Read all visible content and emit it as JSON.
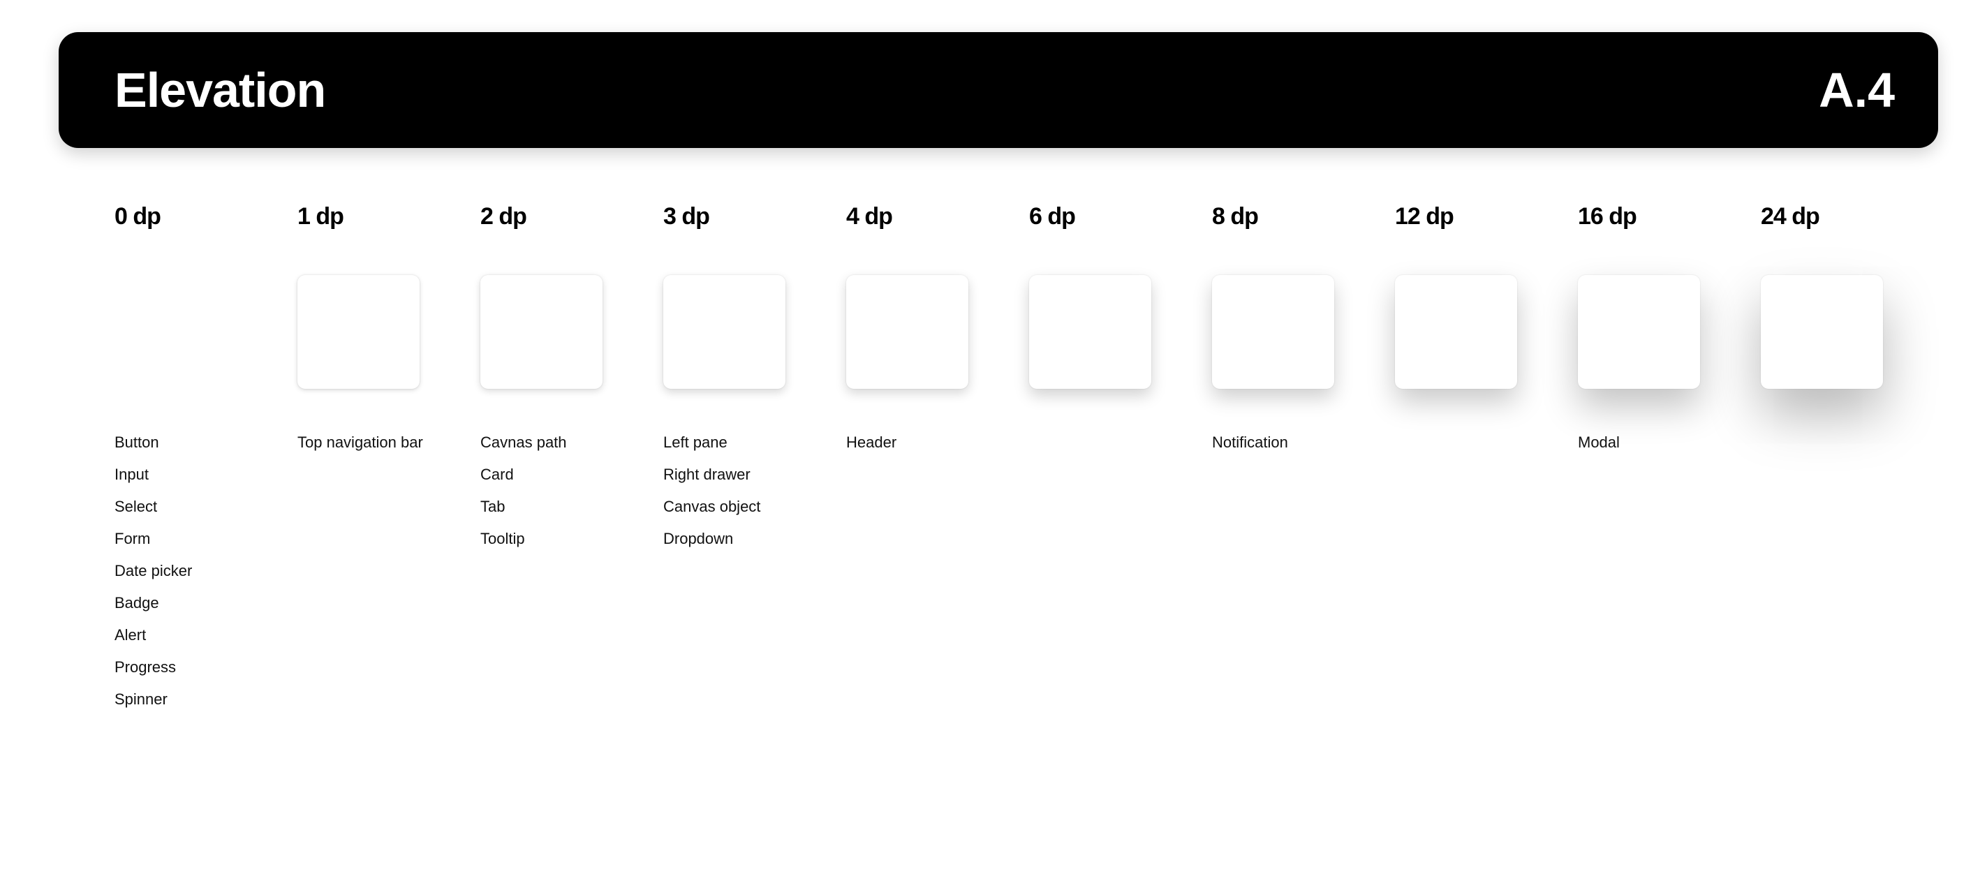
{
  "header": {
    "title": "Elevation",
    "code": "A.4"
  },
  "levels": [
    {
      "label": "0 dp",
      "dp": 0,
      "uses": [
        "Button",
        "Input",
        "Select",
        "Form",
        "Date picker",
        "Badge",
        "Alert",
        "Progress",
        "Spinner"
      ]
    },
    {
      "label": "1 dp",
      "dp": 1,
      "uses": [
        "Top navigation bar"
      ]
    },
    {
      "label": "2 dp",
      "dp": 2,
      "uses": [
        "Cavnas path",
        "Card",
        "Tab",
        "Tooltip"
      ]
    },
    {
      "label": "3 dp",
      "dp": 3,
      "uses": [
        "Left pane",
        "Right drawer",
        "Canvas object",
        "Dropdown"
      ]
    },
    {
      "label": "4 dp",
      "dp": 4,
      "uses": [
        "Header"
      ]
    },
    {
      "label": "6 dp",
      "dp": 6,
      "uses": []
    },
    {
      "label": "8 dp",
      "dp": 8,
      "uses": [
        "Notification"
      ]
    },
    {
      "label": "12 dp",
      "dp": 12,
      "uses": []
    },
    {
      "label": "16 dp",
      "dp": 16,
      "uses": [
        "Modal"
      ]
    },
    {
      "label": "24 dp",
      "dp": 24,
      "uses": []
    }
  ]
}
